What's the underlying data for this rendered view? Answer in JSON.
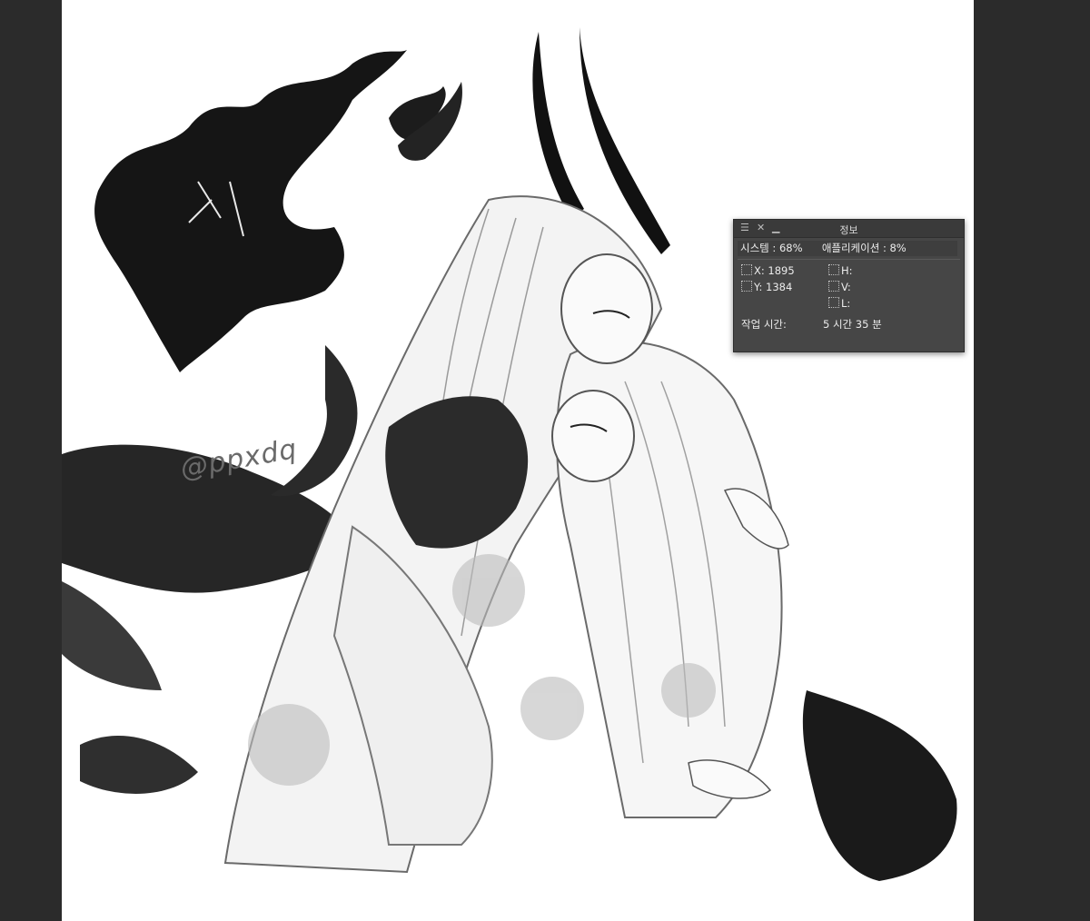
{
  "app": {
    "canvas_background": "#ffffff",
    "workspace_background": "#2b2b2b"
  },
  "artwork": {
    "watermark": "@ppxdq"
  },
  "info_panel": {
    "title": "정보",
    "menu_icon": "hamburger-menu-icon",
    "close_icon": "close-icon",
    "minimize_icon": "minimize-icon",
    "system_label": "시스템 :",
    "system_value": "68%",
    "app_label": "애플리케이션 :",
    "app_value": "8%",
    "x_label": "X:",
    "x_value": "1895",
    "y_label": "Y:",
    "y_value": "1384",
    "h_label": "H:",
    "v_label": "V:",
    "l_label": "L:",
    "work_time_label": "작업 시간:",
    "work_time_value": "5 시간 35 분"
  }
}
